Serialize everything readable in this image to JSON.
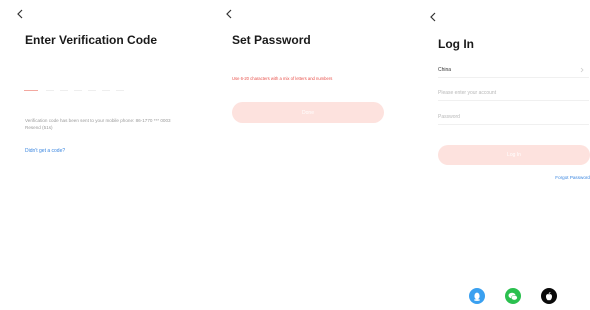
{
  "screens": {
    "verification": {
      "title": "Enter Verification Code",
      "info_text": "Verification code has been sent to your mobile phone: 86-1770 *** 0003 Resend (51s)",
      "help_link": "Didn't get a code?"
    },
    "set_password": {
      "title": "Set Password",
      "password_placeholder": "",
      "hint": "Use 6-20 characters with a mix of letters and numbers",
      "done_button": "Done"
    },
    "login": {
      "title": "Log In",
      "country_value": "China",
      "account_placeholder": "Please enter your account",
      "password_placeholder": "Password",
      "login_button": "Log In",
      "forgot_link": "Forgot Password"
    }
  },
  "social_logins": [
    {
      "icon": "qq-icon",
      "color": "#3aa0f0"
    },
    {
      "icon": "wechat-icon",
      "color": "#2bc04f"
    },
    {
      "icon": "apple-icon",
      "color": "#0a0a0a"
    }
  ],
  "colors": {
    "accent_light": "#fde2de",
    "error_red": "#e8504a",
    "link_blue": "#3a86e0"
  }
}
